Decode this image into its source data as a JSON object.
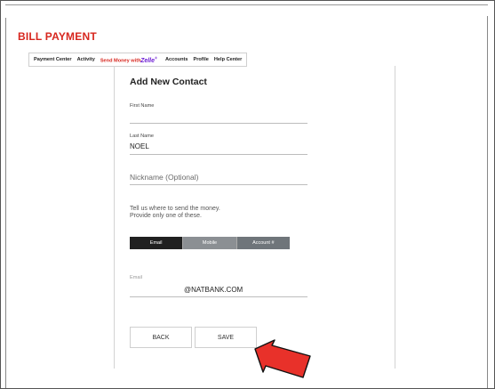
{
  "header": {
    "title": "BILL PAYMENT"
  },
  "nav": {
    "items": [
      "Payment Center",
      "Activity",
      "Send Money with",
      "Zelle",
      "Accounts",
      "Profile",
      "Help Center"
    ],
    "zelle_mark": "®"
  },
  "form": {
    "heading": "Add New Contact",
    "first_name": {
      "label": "First Name",
      "value": ""
    },
    "last_name": {
      "label": "Last Name",
      "value": "NOEL"
    },
    "nickname": {
      "placeholder": "Nickname (Optional)"
    },
    "instruction_line1": "Tell us where to send the money.",
    "instruction_line2": "Provide only one of these.",
    "tabs": [
      "Email",
      "Mobile",
      "Account #"
    ],
    "email": {
      "label": "Email",
      "value": "@NATBANK.COM"
    },
    "buttons": {
      "back": "BACK",
      "save": "SAVE"
    }
  },
  "colors": {
    "brand_red": "#d7261e",
    "zelle_purple": "#6d1ed4",
    "arrow_red": "#e8312a"
  }
}
